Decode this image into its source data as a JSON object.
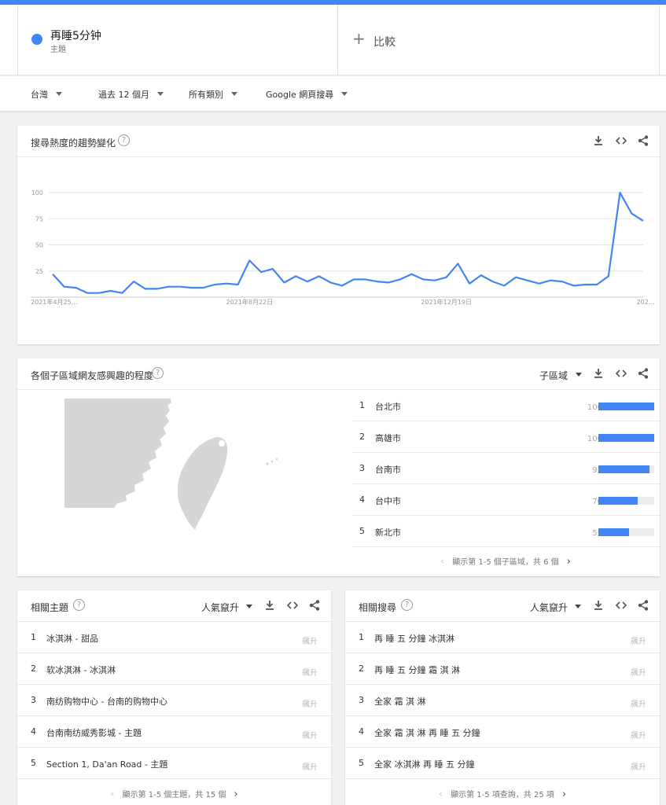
{
  "search_term": {
    "name": "再睡5分钟",
    "type": "主題",
    "color": "#4285f4"
  },
  "compare": {
    "label": "比較"
  },
  "filters": {
    "region": "台灣",
    "period": "過去 12 個月",
    "category": "所有類別",
    "source": "Google 網頁搜尋"
  },
  "trend": {
    "title": "搜尋熱度的趨勢變化",
    "icons": [
      "download-icon",
      "embed-icon",
      "share-icon"
    ],
    "chart_data": {
      "type": "line",
      "yticks": [
        25,
        50,
        75,
        100
      ],
      "ylim": [
        0,
        100
      ],
      "xtick_labels": [
        "2021年4月25…",
        "2021年8月22日",
        "2021年12月19日",
        "202…"
      ],
      "xtick_index": [
        0,
        17,
        34,
        52
      ],
      "series": [
        {
          "values": [
            22,
            10,
            9,
            4,
            4,
            6,
            4,
            15,
            8,
            8,
            10,
            10,
            9,
            9,
            12,
            13,
            12,
            35,
            24,
            27,
            14,
            20,
            15,
            20,
            14,
            11,
            17,
            17,
            15,
            14,
            17,
            22,
            17,
            16,
            19,
            32,
            13,
            21,
            15,
            11,
            19,
            16,
            13,
            16,
            15,
            11,
            12,
            12,
            20,
            100,
            80,
            73
          ],
          "color": "#4285f4"
        }
      ]
    }
  },
  "regions": {
    "title": "各個子區域網友感興趣的程度",
    "dropdown": "子區域",
    "items": [
      {
        "rank": "1",
        "name": "台北市",
        "value": "100",
        "pct": 100
      },
      {
        "rank": "2",
        "name": "高雄市",
        "value": "100",
        "pct": 100
      },
      {
        "rank": "3",
        "name": "台南市",
        "value": "92",
        "pct": 92
      },
      {
        "rank": "4",
        "name": "台中市",
        "value": "70",
        "pct": 70
      },
      {
        "rank": "5",
        "name": "新北市",
        "value": "55",
        "pct": 55
      }
    ],
    "pager": "顯示第 1-5 個子區域，共 6 個"
  },
  "topics": {
    "title": "相關主題",
    "dropdown": "人氣竄升",
    "items": [
      {
        "rank": "1",
        "label": "冰淇淋 - 甜品",
        "badge": "飆升"
      },
      {
        "rank": "2",
        "label": "软冰淇淋 - 冰淇淋",
        "badge": "飆升"
      },
      {
        "rank": "3",
        "label": "南纺购物中心 - 台南的购物中心",
        "badge": "飆升"
      },
      {
        "rank": "4",
        "label": "台南南纺威秀影城 - 主題",
        "badge": "飆升"
      },
      {
        "rank": "5",
        "label": "Section 1, Da'an Road - 主題",
        "badge": "飆升"
      }
    ],
    "pager": "顯示第 1-5 個主題，共 15 個"
  },
  "queries": {
    "title": "相關搜尋",
    "dropdown": "人氣竄升",
    "items": [
      {
        "rank": "1",
        "label": "再 睡 五 分鐘 冰淇淋",
        "badge": "飆升"
      },
      {
        "rank": "2",
        "label": "再 睡 五 分鐘 霜 淇 淋",
        "badge": "飆升"
      },
      {
        "rank": "3",
        "label": "全家 霜 淇 淋",
        "badge": "飆升"
      },
      {
        "rank": "4",
        "label": "全家 霜 淇 淋 再 睡 五 分鐘",
        "badge": "飆升"
      },
      {
        "rank": "5",
        "label": "全家 冰淇淋 再 睡 五 分鐘",
        "badge": "飆升"
      }
    ],
    "pager": "顯示第 1-5 項查詢，共 25 項"
  }
}
